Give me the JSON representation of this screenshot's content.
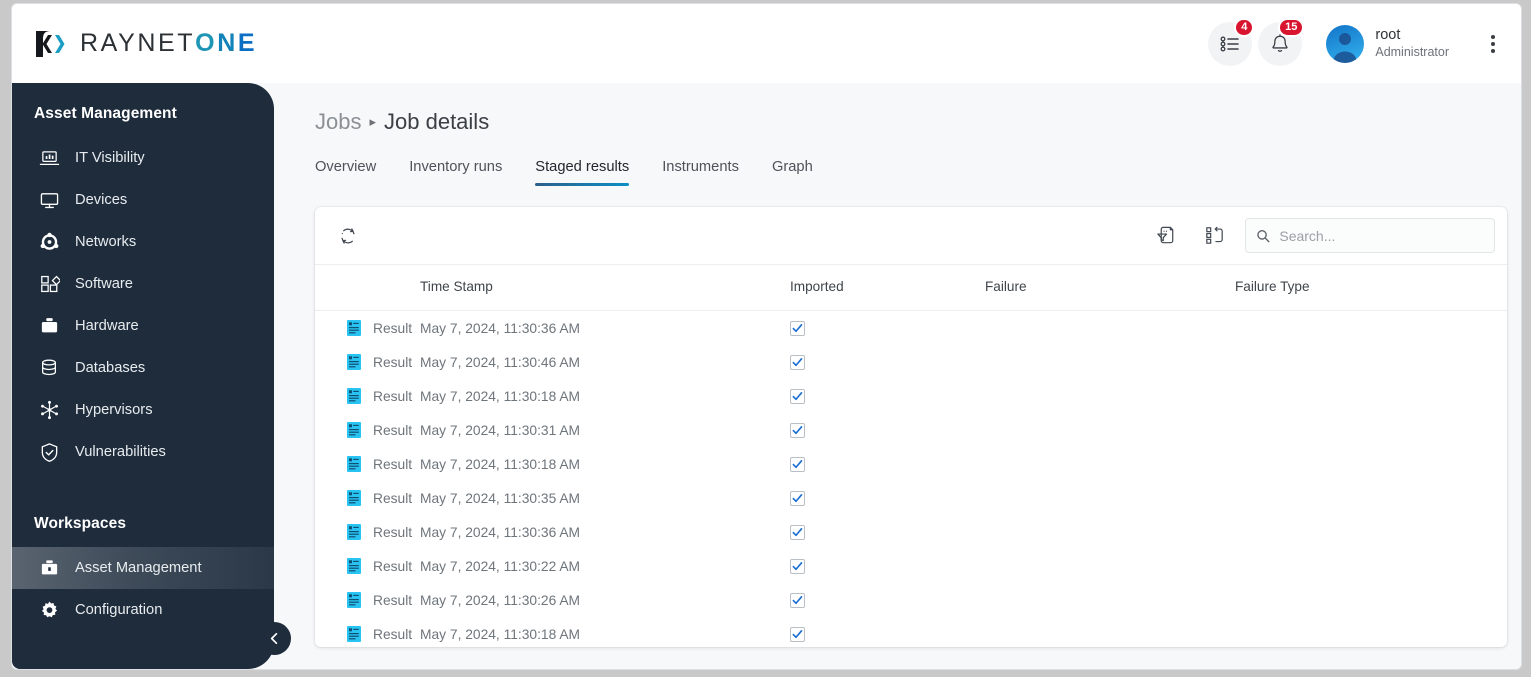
{
  "brand": {
    "name_dark": "RAYNET",
    "name_o": "O",
    "name_n": "N",
    "name_e": "E",
    "mark_dark": "#14181c",
    "mark_teal": "#1a9ec4",
    "color_o": "#1e95b4",
    "color_n": "#1282b8",
    "color_e": "#0d6fc4"
  },
  "topbar": {
    "tasks_badge": "4",
    "notifications_badge": "15",
    "user_name": "root",
    "user_role": "Administrator",
    "badge_color": "#d8152f"
  },
  "sidebar": {
    "section_title": "Asset Management",
    "items": [
      {
        "label": "IT Visibility",
        "icon": "laptop-chart-icon"
      },
      {
        "label": "Devices",
        "icon": "monitor-icon"
      },
      {
        "label": "Networks",
        "icon": "network-nodes-icon"
      },
      {
        "label": "Software",
        "icon": "squares-diamond-icon"
      },
      {
        "label": "Hardware",
        "icon": "toolbox-icon"
      },
      {
        "label": "Databases",
        "icon": "database-icon"
      },
      {
        "label": "Hypervisors",
        "icon": "snowflake-icon"
      },
      {
        "label": "Vulnerabilities",
        "icon": "shield-check-icon"
      }
    ],
    "workspaces_title": "Workspaces",
    "workspaces": [
      {
        "label": "Asset Management",
        "icon": "briefcase-icon",
        "active": true
      },
      {
        "label": "Configuration",
        "icon": "gear-icon",
        "active": false
      }
    ],
    "collapse_icon": "chevron-left-icon",
    "bg": "#1e2c3c"
  },
  "breadcrumb": {
    "parent": "Jobs",
    "separator": "▸",
    "current": "Job details"
  },
  "tabs": [
    {
      "label": "Overview",
      "active": false
    },
    {
      "label": "Inventory runs",
      "active": false
    },
    {
      "label": "Staged results",
      "active": true
    },
    {
      "label": "Instruments",
      "active": false
    },
    {
      "label": "Graph",
      "active": false
    }
  ],
  "toolbar": {
    "refresh_icon": "refresh-circular-arrows-icon",
    "filter_export_icon": "document-filter-icon",
    "columns_icon": "column-layout-icon",
    "search_icon": "search-icon",
    "search_placeholder": "Search...",
    "search_value": ""
  },
  "table": {
    "columns": [
      "",
      "Time Stamp",
      "Imported",
      "Failure",
      "Failure Type"
    ],
    "rows": [
      {
        "type": "Result",
        "timestamp": "May 7, 2024, 11:30:36 AM",
        "imported": true,
        "failure": "",
        "failure_type": ""
      },
      {
        "type": "Result",
        "timestamp": "May 7, 2024, 11:30:46 AM",
        "imported": true,
        "failure": "",
        "failure_type": ""
      },
      {
        "type": "Result",
        "timestamp": "May 7, 2024, 11:30:18 AM",
        "imported": true,
        "failure": "",
        "failure_type": ""
      },
      {
        "type": "Result",
        "timestamp": "May 7, 2024, 11:30:31 AM",
        "imported": true,
        "failure": "",
        "failure_type": ""
      },
      {
        "type": "Result",
        "timestamp": "May 7, 2024, 11:30:18 AM",
        "imported": true,
        "failure": "",
        "failure_type": ""
      },
      {
        "type": "Result",
        "timestamp": "May 7, 2024, 11:30:35 AM",
        "imported": true,
        "failure": "",
        "failure_type": ""
      },
      {
        "type": "Result",
        "timestamp": "May 7, 2024, 11:30:36 AM",
        "imported": true,
        "failure": "",
        "failure_type": ""
      },
      {
        "type": "Result",
        "timestamp": "May 7, 2024, 11:30:22 AM",
        "imported": true,
        "failure": "",
        "failure_type": ""
      },
      {
        "type": "Result",
        "timestamp": "May 7, 2024, 11:30:26 AM",
        "imported": true,
        "failure": "",
        "failure_type": ""
      },
      {
        "type": "Result",
        "timestamp": "May 7, 2024, 11:30:18 AM",
        "imported": true,
        "failure": "",
        "failure_type": ""
      }
    ]
  }
}
